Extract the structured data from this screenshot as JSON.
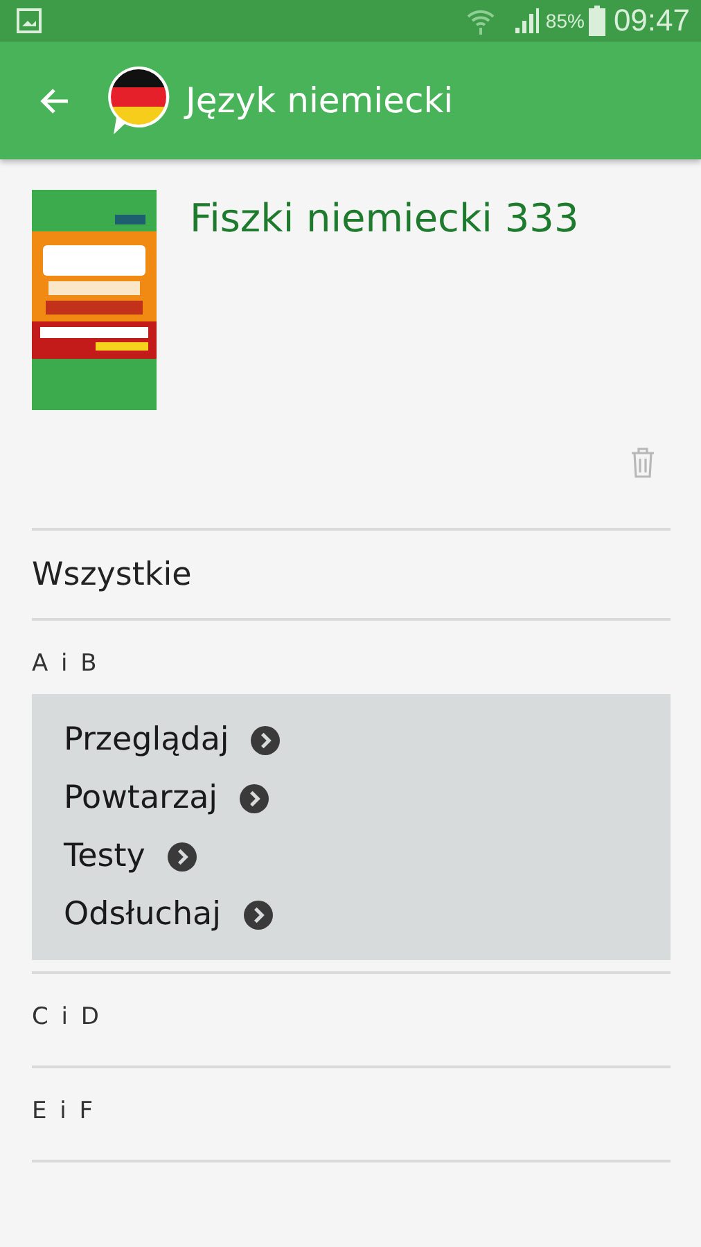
{
  "status_bar": {
    "battery": "85%",
    "time": "09:47"
  },
  "app_bar": {
    "title": "Język niemiecki"
  },
  "deck": {
    "title": "Fiszki niemiecki 333"
  },
  "sections": [
    {
      "kind": "all",
      "label": "Wszystkie"
    },
    {
      "kind": "group",
      "label": "A i B",
      "expanded": true,
      "actions": [
        "Przeglądaj",
        "Powtarzaj",
        "Testy",
        "Odsłuchaj"
      ]
    },
    {
      "kind": "group",
      "label": "C i D",
      "expanded": false
    },
    {
      "kind": "group",
      "label": "E i F",
      "expanded": false
    }
  ]
}
